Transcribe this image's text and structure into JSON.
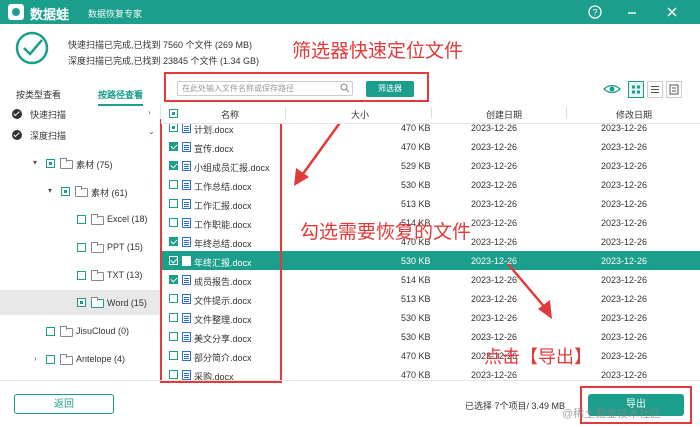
{
  "app": {
    "name": "数据蛙",
    "subtitle": "数据恢复专家",
    "help_icon": "help-icon",
    "min_icon": "minimize-icon",
    "close_icon": "close-icon"
  },
  "summary": {
    "quick_scan": "快速扫描已完成,已找到 7560 个文件 (269 MB)",
    "deep_scan": "深度扫描已完成,已找到 23845 个文件 (1.34 GB)"
  },
  "annotations": {
    "filter_tip": "筛选器快速定位文件",
    "check_tip": "勾选需要恢复的文件",
    "export_tip": "点击【导出】",
    "color": "#e23a3a"
  },
  "tabs": [
    {
      "label": "按类型查看",
      "active": false
    },
    {
      "label": "按路径查看",
      "active": true
    }
  ],
  "search": {
    "placeholder": "在此处输入文件名称或保存路径",
    "filter_label": "筛选器"
  },
  "sidebar": {
    "items": [
      {
        "label": "快速扫描",
        "level": 0,
        "kind": "root"
      },
      {
        "label": "深度扫描",
        "level": 0,
        "kind": "root"
      },
      {
        "label": "素材 (75)",
        "level": 1,
        "expanded": true,
        "check": "partial"
      },
      {
        "label": "素材 (61)",
        "level": 2,
        "expanded": true,
        "check": "partial"
      },
      {
        "label": "Excel (18)",
        "level": 3,
        "check": "none"
      },
      {
        "label": "PPT (15)",
        "level": 3,
        "check": "none"
      },
      {
        "label": "TXT (13)",
        "level": 3,
        "check": "none"
      },
      {
        "label": "Word (15)",
        "level": 3,
        "check": "partial",
        "selected": true
      },
      {
        "label": "JisuCloud (0)",
        "level": 1,
        "check": "none"
      },
      {
        "label": "Antelope (4)",
        "level": 1,
        "collapsed": true,
        "check": "none"
      }
    ]
  },
  "table": {
    "headers": {
      "name": "名称",
      "size": "大小",
      "created": "创建日期",
      "modified": "修改日期"
    },
    "rows": [
      {
        "name": "计划.docx",
        "size": "470 KB",
        "created": "2023-12-26",
        "modified": "2023-12-26",
        "checked": false,
        "partial": true
      },
      {
        "name": "宣传.docx",
        "size": "470 KB",
        "created": "2023-12-26",
        "modified": "2023-12-26",
        "checked": true
      },
      {
        "name": "小组成员汇报.docx",
        "size": "529 KB",
        "created": "2023-12-26",
        "modified": "2023-12-26",
        "checked": true
      },
      {
        "name": "工作总结.docx",
        "size": "530 KB",
        "created": "2023-12-26",
        "modified": "2023-12-26",
        "checked": false
      },
      {
        "name": "工作汇报.docx",
        "size": "513 KB",
        "created": "2023-12-26",
        "modified": "2023-12-26",
        "checked": false
      },
      {
        "name": "工作职能.docx",
        "size": "514 KB",
        "created": "2023-12-26",
        "modified": "2023-12-26",
        "checked": false
      },
      {
        "name": "年终总结.docx",
        "size": "470 KB",
        "created": "2023-12-26",
        "modified": "2023-12-26",
        "checked": true
      },
      {
        "name": "年终汇报.docx",
        "size": "530 KB",
        "created": "2023-12-26",
        "modified": "2023-12-26",
        "checked": true,
        "selected": true
      },
      {
        "name": "成员报告.docx",
        "size": "514 KB",
        "created": "2023-12-26",
        "modified": "2023-12-26",
        "checked": true
      },
      {
        "name": "文件提示.docx",
        "size": "513 KB",
        "created": "2023-12-26",
        "modified": "2023-12-26",
        "checked": false
      },
      {
        "name": "文件整理.docx",
        "size": "530 KB",
        "created": "2023-12-26",
        "modified": "2023-12-26",
        "checked": false
      },
      {
        "name": "美文分享.docx",
        "size": "530 KB",
        "created": "2023-12-26",
        "modified": "2023-12-26",
        "checked": false
      },
      {
        "name": "部分简介.docx",
        "size": "470 KB",
        "created": "2023-12-26",
        "modified": "2023-12-26",
        "checked": false
      },
      {
        "name": "采购.docx",
        "size": "470 KB",
        "created": "2023-12-26",
        "modified": "2023-12-26",
        "checked": false
      }
    ]
  },
  "footer": {
    "back_label": "返回",
    "selection_info": "已选择 7个项目/ 3.49 MB",
    "export_label": "导出"
  },
  "watermark": "@稀土掘金技术社区",
  "colors": {
    "accent": "#1c9e8c",
    "annotation": "#e23a3a"
  }
}
